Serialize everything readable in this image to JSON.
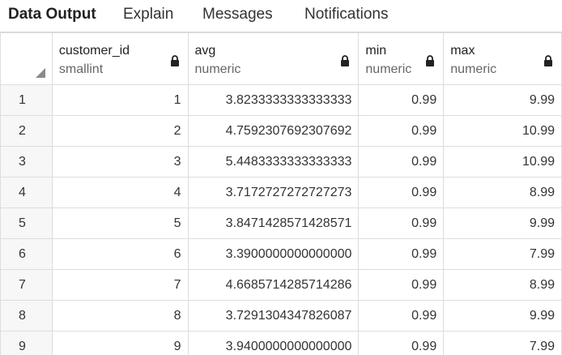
{
  "tabs": [
    {
      "label": "Data Output",
      "active": true
    },
    {
      "label": "Explain",
      "active": false
    },
    {
      "label": "Messages",
      "active": false
    },
    {
      "label": "Notifications",
      "active": false
    }
  ],
  "columns": [
    {
      "name": "customer_id",
      "type": "smallint"
    },
    {
      "name": "avg",
      "type": "numeric"
    },
    {
      "name": "min",
      "type": "numeric"
    },
    {
      "name": "max",
      "type": "numeric"
    }
  ],
  "rows": [
    {
      "row": "1",
      "customer_id": "1",
      "avg": "3.8233333333333333",
      "min": "0.99",
      "max": "9.99"
    },
    {
      "row": "2",
      "customer_id": "2",
      "avg": "4.7592307692307692",
      "min": "0.99",
      "max": "10.99"
    },
    {
      "row": "3",
      "customer_id": "3",
      "avg": "5.4483333333333333",
      "min": "0.99",
      "max": "10.99"
    },
    {
      "row": "4",
      "customer_id": "4",
      "avg": "3.7172727272727273",
      "min": "0.99",
      "max": "8.99"
    },
    {
      "row": "5",
      "customer_id": "5",
      "avg": "3.8471428571428571",
      "min": "0.99",
      "max": "9.99"
    },
    {
      "row": "6",
      "customer_id": "6",
      "avg": "3.3900000000000000",
      "min": "0.99",
      "max": "7.99"
    },
    {
      "row": "7",
      "customer_id": "7",
      "avg": "4.6685714285714286",
      "min": "0.99",
      "max": "8.99"
    },
    {
      "row": "8",
      "customer_id": "8",
      "avg": "3.7291304347826087",
      "min": "0.99",
      "max": "9.99"
    },
    {
      "row": "9",
      "customer_id": "9",
      "avg": "3.9400000000000000",
      "min": "0.99",
      "max": "7.99"
    }
  ]
}
